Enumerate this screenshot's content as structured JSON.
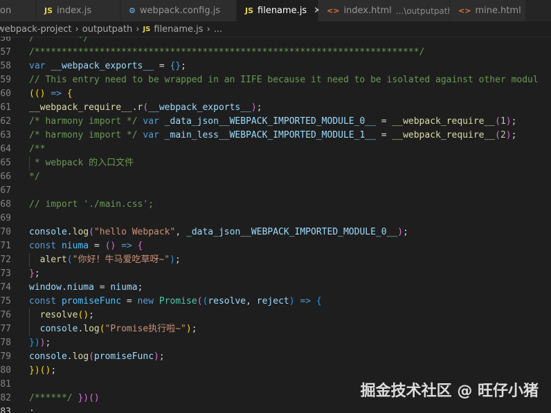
{
  "tabs": [
    {
      "label": "on",
      "icon": "",
      "active": false
    },
    {
      "label": "index.js",
      "icon": "js",
      "active": false
    },
    {
      "label": "webpack.config.js",
      "icon": "gear",
      "active": false
    },
    {
      "label": "filename.js",
      "icon": "js",
      "active": true
    },
    {
      "label": "index.html",
      "icon": "html",
      "desc": "...\\outputpath",
      "active": false
    },
    {
      "label": "mine.html",
      "icon": "html",
      "active": false
    }
  ],
  "tab_icon_glyphs": {
    "js": "JS",
    "gear": "⚙",
    "html": "<>"
  },
  "breadcrumb": [
    "webpack-project",
    "outputpath",
    "filename.js",
    "..."
  ],
  "current_line": 83,
  "lines": [
    {
      "n": 56,
      "tokens": [
        [
          "/        */",
          "#6a9955"
        ]
      ]
    },
    {
      "n": 57,
      "tokens": [
        [
          "/***********************************************************************/",
          "#6a9955"
        ]
      ]
    },
    {
      "n": 58,
      "tokens": [
        [
          "var",
          "#569cd6"
        ],
        [
          " __webpack_exports__ ",
          "#9cdcfe"
        ],
        [
          "= ",
          "#d4d4d4"
        ],
        [
          "{}",
          "#569cd6"
        ],
        [
          ";",
          "#d4d4d4"
        ]
      ]
    },
    {
      "n": 59,
      "tokens": [
        [
          "// This entry need to be wrapped in an IIFE because it need to be isolated against other modul",
          "#6a9955"
        ]
      ]
    },
    {
      "n": 60,
      "tokens": [
        [
          "(() ",
          "#ffd700"
        ],
        [
          "=>",
          "#569cd6"
        ],
        [
          " {",
          "#ffd700"
        ]
      ]
    },
    {
      "n": 61,
      "tokens": [
        [
          "__webpack_require__",
          "#dcdcaa"
        ],
        [
          ".",
          "#d4d4d4"
        ],
        [
          "r",
          "#dcdcaa"
        ],
        [
          "(",
          "#da70d6"
        ],
        [
          "__webpack_exports__",
          "#9cdcfe"
        ],
        [
          ")",
          "#da70d6"
        ],
        [
          ";",
          "#d4d4d4"
        ]
      ]
    },
    {
      "n": 62,
      "tokens": [
        [
          "/* harmony import */ ",
          "#6a9955"
        ],
        [
          "var",
          "#569cd6"
        ],
        [
          " _data_json__WEBPACK_IMPORTED_MODULE_0__ ",
          "#9cdcfe"
        ],
        [
          "= ",
          "#d4d4d4"
        ],
        [
          "__webpack_require__",
          "#dcdcaa"
        ],
        [
          "(",
          "#da70d6"
        ],
        [
          "1",
          "#b5cea8"
        ],
        [
          ")",
          "#da70d6"
        ],
        [
          ";",
          "#d4d4d4"
        ]
      ]
    },
    {
      "n": 63,
      "tokens": [
        [
          "/* harmony import */ ",
          "#6a9955"
        ],
        [
          "var",
          "#569cd6"
        ],
        [
          " _main_less__WEBPACK_IMPORTED_MODULE_1__ ",
          "#9cdcfe"
        ],
        [
          "= ",
          "#d4d4d4"
        ],
        [
          "__webpack_require__",
          "#dcdcaa"
        ],
        [
          "(",
          "#da70d6"
        ],
        [
          "2",
          "#b5cea8"
        ],
        [
          ")",
          "#da70d6"
        ],
        [
          ";",
          "#d4d4d4"
        ]
      ]
    },
    {
      "n": 64,
      "tokens": [
        [
          "/**",
          "#6a9955"
        ]
      ]
    },
    {
      "n": 65,
      "tokens": [
        [
          " * webpack 的入口文件",
          "#6a9955"
        ]
      ]
    },
    {
      "n": 66,
      "tokens": [
        [
          "*/",
          "#6a9955"
        ]
      ]
    },
    {
      "n": 67,
      "tokens": []
    },
    {
      "n": 68,
      "tokens": [
        [
          "// import './main.css';",
          "#6a9955"
        ]
      ]
    },
    {
      "n": 69,
      "tokens": []
    },
    {
      "n": 70,
      "tokens": [
        [
          "console",
          "#9cdcfe"
        ],
        [
          ".",
          "#d4d4d4"
        ],
        [
          "log",
          "#dcdcaa"
        ],
        [
          "(",
          "#da70d6"
        ],
        [
          "\"hello Webpack\"",
          "#ce9178"
        ],
        [
          ", ",
          "#d4d4d4"
        ],
        [
          "_data_json__WEBPACK_IMPORTED_MODULE_0__",
          "#9cdcfe"
        ],
        [
          ")",
          "#da70d6"
        ],
        [
          ";",
          "#d4d4d4"
        ]
      ]
    },
    {
      "n": 71,
      "tokens": [
        [
          "const",
          "#569cd6"
        ],
        [
          " niuma ",
          "#4fc1ff"
        ],
        [
          "= ",
          "#d4d4d4"
        ],
        [
          "() ",
          "#da70d6"
        ],
        [
          "=>",
          "#569cd6"
        ],
        [
          " {",
          "#da70d6"
        ]
      ]
    },
    {
      "n": 72,
      "tokens": [
        [
          "  alert",
          "#dcdcaa"
        ],
        [
          "(",
          "#179fff"
        ],
        [
          "\"你好！牛马爱吃草呀~\"",
          "#ce9178"
        ],
        [
          ")",
          "#179fff"
        ],
        [
          ";",
          "#d4d4d4"
        ]
      ]
    },
    {
      "n": 73,
      "tokens": [
        [
          "}",
          "#da70d6"
        ],
        [
          ";",
          "#d4d4d4"
        ]
      ]
    },
    {
      "n": 74,
      "tokens": [
        [
          "window",
          "#9cdcfe"
        ],
        [
          ".",
          "#d4d4d4"
        ],
        [
          "niuma ",
          "#9cdcfe"
        ],
        [
          "= ",
          "#d4d4d4"
        ],
        [
          "niuma",
          "#9cdcfe"
        ],
        [
          ";",
          "#d4d4d4"
        ]
      ]
    },
    {
      "n": 75,
      "tokens": [
        [
          "const",
          "#569cd6"
        ],
        [
          " promiseFunc ",
          "#4fc1ff"
        ],
        [
          "= ",
          "#d4d4d4"
        ],
        [
          "new",
          "#569cd6"
        ],
        [
          " Promise",
          "#4ec9b0"
        ],
        [
          "(",
          "#da70d6"
        ],
        [
          "(",
          "#179fff"
        ],
        [
          "resolve",
          "#9cdcfe"
        ],
        [
          ", ",
          "#d4d4d4"
        ],
        [
          "reject",
          "#9cdcfe"
        ],
        [
          ") ",
          "#179fff"
        ],
        [
          "=>",
          "#569cd6"
        ],
        [
          " {",
          "#179fff"
        ]
      ]
    },
    {
      "n": 76,
      "tokens": [
        [
          "  resolve",
          "#dcdcaa"
        ],
        [
          "()",
          "#ffd700"
        ],
        [
          ";",
          "#d4d4d4"
        ]
      ]
    },
    {
      "n": 77,
      "tokens": [
        [
          "  console",
          "#9cdcfe"
        ],
        [
          ".",
          "#d4d4d4"
        ],
        [
          "log",
          "#dcdcaa"
        ],
        [
          "(",
          "#ffd700"
        ],
        [
          "\"Promise执行啦~\"",
          "#ce9178"
        ],
        [
          ")",
          "#ffd700"
        ],
        [
          ";",
          "#d4d4d4"
        ]
      ]
    },
    {
      "n": 78,
      "tokens": [
        [
          "})",
          "#179fff"
        ],
        [
          ")",
          "#da70d6"
        ],
        [
          ";",
          "#d4d4d4"
        ]
      ]
    },
    {
      "n": 79,
      "tokens": [
        [
          "console",
          "#9cdcfe"
        ],
        [
          ".",
          "#d4d4d4"
        ],
        [
          "log",
          "#dcdcaa"
        ],
        [
          "(",
          "#da70d6"
        ],
        [
          "promiseFunc",
          "#9cdcfe"
        ],
        [
          ")",
          "#da70d6"
        ],
        [
          ";",
          "#d4d4d4"
        ]
      ]
    },
    {
      "n": 80,
      "tokens": [
        [
          "})",
          "#ffd700"
        ],
        [
          "()",
          "#ffd700"
        ],
        [
          ";",
          "#d4d4d4"
        ]
      ]
    },
    {
      "n": 81,
      "tokens": []
    },
    {
      "n": 82,
      "tokens": [
        [
          "/******/ ",
          "#6a9955"
        ],
        [
          "})",
          "#da70d6"
        ],
        [
          "()",
          "#da70d6"
        ]
      ]
    },
    {
      "n": 83,
      "tokens": [
        [
          ";",
          "#d4d4d4"
        ]
      ]
    }
  ],
  "watermark": "掘金技术社区 @ 旺仔小猪"
}
